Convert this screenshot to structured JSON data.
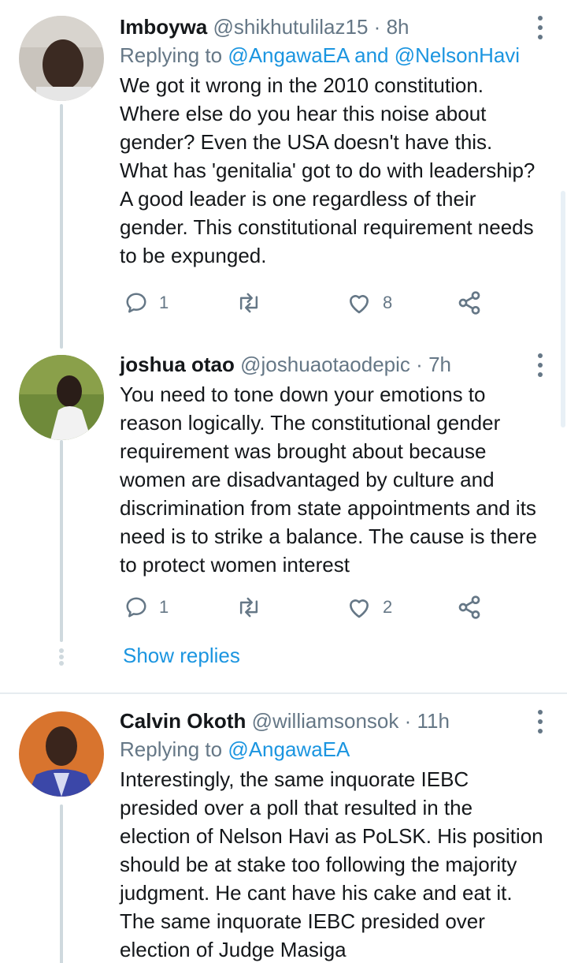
{
  "tweets": [
    {
      "name": "Imboywa",
      "handle": "@shikhutulilaz15",
      "sep": "·",
      "time": "8h",
      "replying_prefix": "Replying to",
      "replying_to": "@AngawaEA and @NelsonHavi",
      "text": "We got it wrong in the 2010 constitution. Where else do you hear this noise about gender? Even the USA doesn't have this. What has 'genitalia' got to do with leadership? A good leader is one regardless of their gender. This constitutional requirement needs to be expunged.",
      "replies": "1",
      "retweets": "",
      "likes": "8"
    },
    {
      "name": "joshua otao",
      "handle": "@joshuaotaodepic",
      "sep": "·",
      "time": "7h",
      "text": "You need to tone down your emotions to reason logically. The constitutional gender requirement was brought about because women are disadvantaged by culture and discrimination from state appointments and its need is to strike a balance. The cause is there to protect women interest",
      "replies": "1",
      "retweets": "",
      "likes": "2"
    },
    {
      "name": "Calvin Okoth",
      "handle": "@williamsonsok",
      "sep": "·",
      "time": "11h",
      "replying_prefix": "Replying to",
      "replying_to": "@AngawaEA",
      "text": "Interestingly, the same inquorate IEBC presided over a poll that resulted in the election of Nelson Havi as PoLSK. His position should be at stake too following the majority judgment. He cant have his cake and eat it. The same inquorate IEBC presided over election of Judge Masiga"
    }
  ],
  "show_replies": "Show replies",
  "colors": {
    "link": "#1b95e0",
    "muted": "#657786",
    "thread": "#cfd9de"
  },
  "icons": [
    "reply-icon",
    "retweet-icon",
    "like-icon",
    "share-icon",
    "more-options-icon"
  ]
}
